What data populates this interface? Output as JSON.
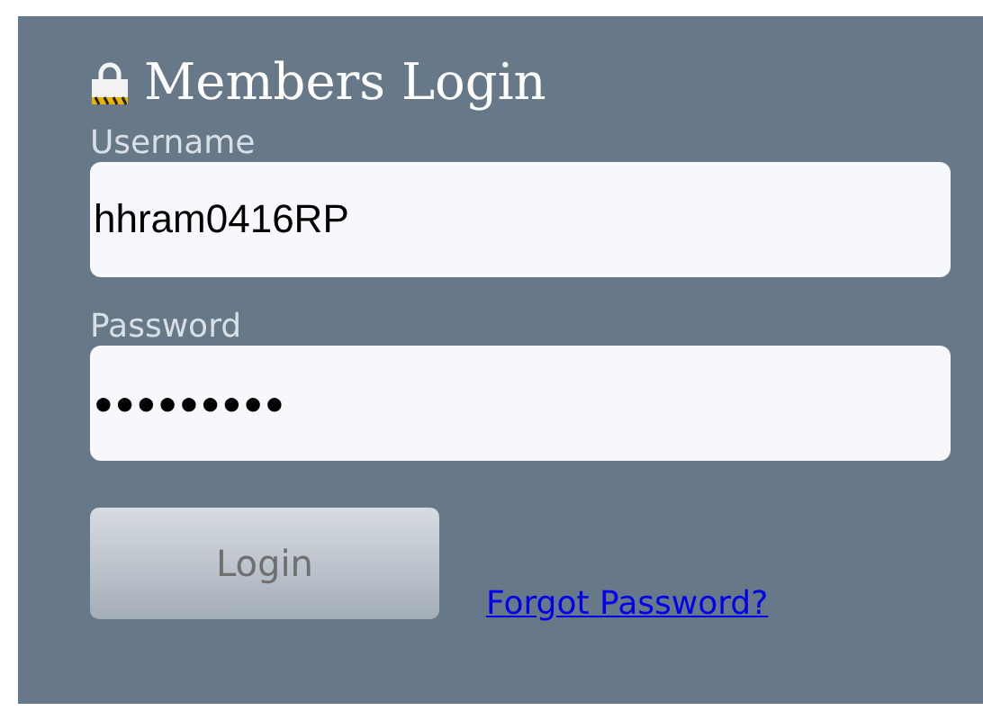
{
  "title": "Members Login",
  "fields": [
    {
      "label": "Username",
      "value": "hhram0416RP"
    },
    {
      "label": "Password",
      "value": "●●●●●●●●●"
    }
  ],
  "button": "Login",
  "link": "Forgot Password?"
}
